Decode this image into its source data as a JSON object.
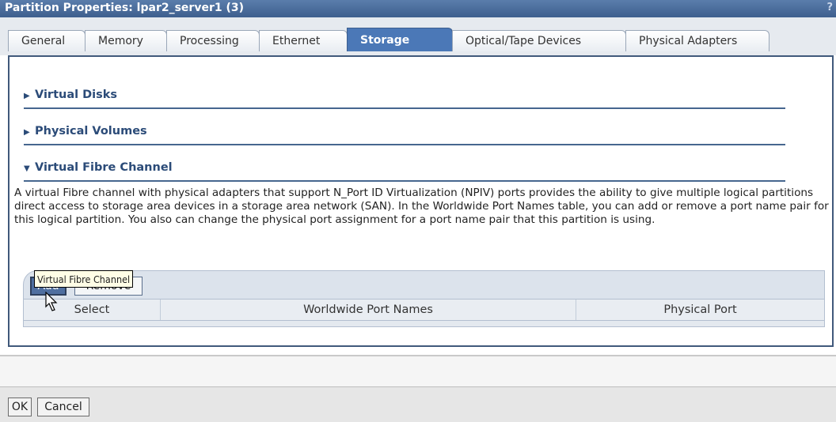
{
  "window": {
    "title": "Partition Properties: lpar2_server1 (3)",
    "help_label": "?"
  },
  "tabs": [
    {
      "label": "General",
      "active": false
    },
    {
      "label": "Memory",
      "active": false
    },
    {
      "label": "Processing",
      "active": false
    },
    {
      "label": "Ethernet",
      "active": false
    },
    {
      "label": "Storage",
      "active": true
    },
    {
      "label": "Optical/Tape Devices",
      "active": false
    },
    {
      "label": "Physical Adapters",
      "active": false
    }
  ],
  "sections": {
    "virtual_disks": {
      "label": "Virtual Disks",
      "expanded": false
    },
    "physical_volumes": {
      "label": "Physical Volumes",
      "expanded": false
    },
    "virtual_fibre_channel": {
      "label": "Virtual Fibre Channel",
      "expanded": true
    }
  },
  "description": "A virtual Fibre channel with physical adapters that support N_Port ID Virtualization (NPIV) ports provides the ability to give multiple logical partitions direct access to storage area devices in a storage area network (SAN). In the Worldwide Port Names table, you can add or remove a port name pair for this logical partition. You also can change the physical port assignment for a port name pair that this partition is using.",
  "table": {
    "buttons": {
      "add": "Add",
      "remove": "Remove"
    },
    "columns": [
      "Select",
      "Worldwide Port Names",
      "Physical Port"
    ],
    "rows": []
  },
  "tooltip": "Virtual Fibre Channel",
  "dialog_buttons": {
    "ok": "OK",
    "cancel": "Cancel"
  },
  "colors": {
    "accent": "#4b78b7",
    "title_bar": "#3e5f8e",
    "section_rule": "#46668f"
  }
}
